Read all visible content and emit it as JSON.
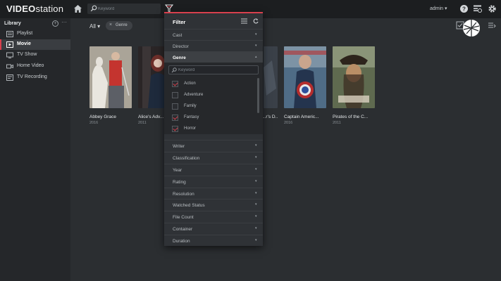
{
  "topbar": {
    "logo_bold": "VIDEO",
    "logo_light": "station",
    "search_placeholder": "Keyword",
    "user": "admin ▾"
  },
  "sidebar": {
    "header": "Library",
    "add_symbol": "+",
    "more_symbol": "···",
    "items": [
      {
        "label": "Playlist",
        "icon": "playlist-icon"
      },
      {
        "label": "Movie",
        "icon": "movie-icon",
        "active": true
      },
      {
        "label": "TV Show",
        "icon": "tv-icon"
      },
      {
        "label": "Home Video",
        "icon": "camera-icon"
      },
      {
        "label": "TV Recording",
        "icon": "recording-icon"
      }
    ]
  },
  "toolbar": {
    "all_label": "All ▾",
    "chip_remove": "×",
    "chip_label": "Genre"
  },
  "movies": [
    {
      "title": "Abbey Grace",
      "year": "2016"
    },
    {
      "title": "Alice's Adv...",
      "year": "2011"
    },
    {
      "title": "...r's D...",
      "year": ""
    },
    {
      "title": "Captain Americ...",
      "year": "2016"
    },
    {
      "title": "Pirates of the C...",
      "year": "2011"
    }
  ],
  "filter": {
    "title": "Filter",
    "chevron": "▾",
    "chevron_open": "▴",
    "rows_top": [
      "Cast",
      "Director"
    ],
    "open_row": "Genre",
    "keyword_placeholder": "Keyword",
    "genres": [
      {
        "label": "Action",
        "checked": true
      },
      {
        "label": "Adventure",
        "checked": false
      },
      {
        "label": "Family",
        "checked": false
      },
      {
        "label": "Fantasy",
        "checked": true
      },
      {
        "label": "Horror",
        "checked": true
      }
    ],
    "rows_bottom": [
      "Writer",
      "Classification",
      "Year",
      "Rating",
      "Resolution",
      "Watched Status",
      "File Count",
      "Container",
      "Duration"
    ]
  },
  "colors": {
    "accent": "#d8404d",
    "background": "#2b2e31",
    "topbar": "#1c1e20",
    "sidebar": "#25272a"
  }
}
